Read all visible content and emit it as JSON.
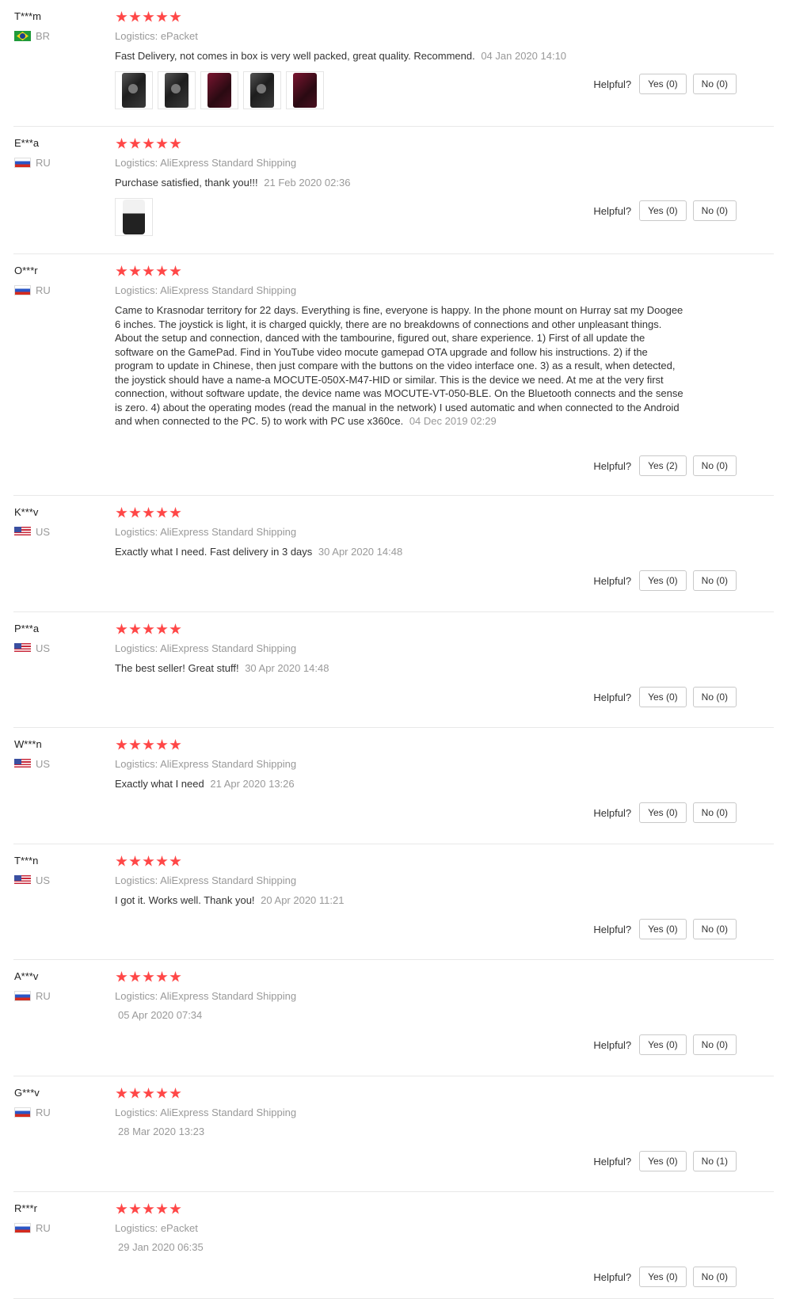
{
  "helpful_label": "Helpful?",
  "logistics_label": "Logistics:",
  "star_color": "#ff4747",
  "reviews": [
    {
      "user": "T***m",
      "country": "BR",
      "flag": "br-flag",
      "rating": 5,
      "logistics": "ePacket",
      "text": "Fast Delivery, not comes in box is very well packed, great quality. Recommend.",
      "date": "04 Jan 2020 14:10",
      "yes": "Yes (0)",
      "no": "No (0)",
      "images": 5
    },
    {
      "user": "E***a",
      "country": "RU",
      "flag": "ru-flag",
      "rating": 5,
      "logistics": "AliExpress Standard Shipping",
      "text": "Purchase satisfied, thank you!!!",
      "date": "21 Feb 2020 02:36",
      "yes": "Yes (0)",
      "no": "No (0)",
      "images": 1
    },
    {
      "user": "O***r",
      "country": "RU",
      "flag": "ru-flag",
      "rating": 5,
      "logistics": "AliExpress Standard Shipping",
      "text": "Came to Krasnodar territory for 22 days. Everything is fine, everyone is happy. In the phone mount on Hurray sat my Doogee 6 inches. The joystick is light, it is charged quickly, there are no breakdowns of connections and other unpleasant things. About the setup and connection, danced with the tambourine, figured out, share experience. 1) First of all update the software on the GamePad. Find in YouTube video mocute gamepad OTA upgrade and follow his instructions. 2) if the program to update in Chinese, then just compare with the buttons on the video interface one. 3) as a result, when detected, the joystick should have a name-a MOCUTE-050X-M47-HID or similar. This is the device we need. At me at the very first connection, without software update, the device name was MOCUTE-VT-050-BLE. On the Bluetooth connects and the sense is zero. 4) about the operating modes (read the manual in the network) I used automatic and when connected to the Android and when connected to the PC. 5) to work with PC use x360ce.",
      "date": "04 Dec 2019 02:29",
      "yes": "Yes (2)",
      "no": "No (0)",
      "images": 0
    },
    {
      "user": "K***v",
      "country": "US",
      "flag": "us-flag",
      "rating": 5,
      "logistics": "AliExpress Standard Shipping",
      "text": "Exactly what I need. Fast delivery in 3 days",
      "date": "30 Apr 2020 14:48",
      "yes": "Yes (0)",
      "no": "No (0)",
      "images": 0
    },
    {
      "user": "P***a",
      "country": "US",
      "flag": "us-flag",
      "rating": 5,
      "logistics": "AliExpress Standard Shipping",
      "text": "The best seller! Great stuff!",
      "date": "30 Apr 2020 14:48",
      "yes": "Yes (0)",
      "no": "No (0)",
      "images": 0
    },
    {
      "user": "W***n",
      "country": "US",
      "flag": "us-flag",
      "rating": 5,
      "logistics": "AliExpress Standard Shipping",
      "text": "Exactly what I need",
      "date": "21 Apr 2020 13:26",
      "yes": "Yes (0)",
      "no": "No (0)",
      "images": 0
    },
    {
      "user": "T***n",
      "country": "US",
      "flag": "us-flag",
      "rating": 5,
      "logistics": "AliExpress Standard Shipping",
      "text": "I got it. Works well. Thank you!",
      "date": "20 Apr 2020 11:21",
      "yes": "Yes (0)",
      "no": "No (0)",
      "images": 0
    },
    {
      "user": "A***v",
      "country": "RU",
      "flag": "ru-flag",
      "rating": 5,
      "logistics": "AliExpress Standard Shipping",
      "text": "",
      "date": "05 Apr 2020 07:34",
      "yes": "Yes (0)",
      "no": "No (0)",
      "images": 0
    },
    {
      "user": "G***v",
      "country": "RU",
      "flag": "ru-flag",
      "rating": 5,
      "logistics": "AliExpress Standard Shipping",
      "text": "",
      "date": "28 Mar 2020 13:23",
      "yes": "Yes (0)",
      "no": "No (1)",
      "images": 0
    },
    {
      "user": "R***r",
      "country": "RU",
      "flag": "ru-flag",
      "rating": 5,
      "logistics": "ePacket",
      "text": "",
      "date": "29 Jan 2020 06:35",
      "yes": "Yes (0)",
      "no": "No (0)",
      "images": 0
    }
  ]
}
